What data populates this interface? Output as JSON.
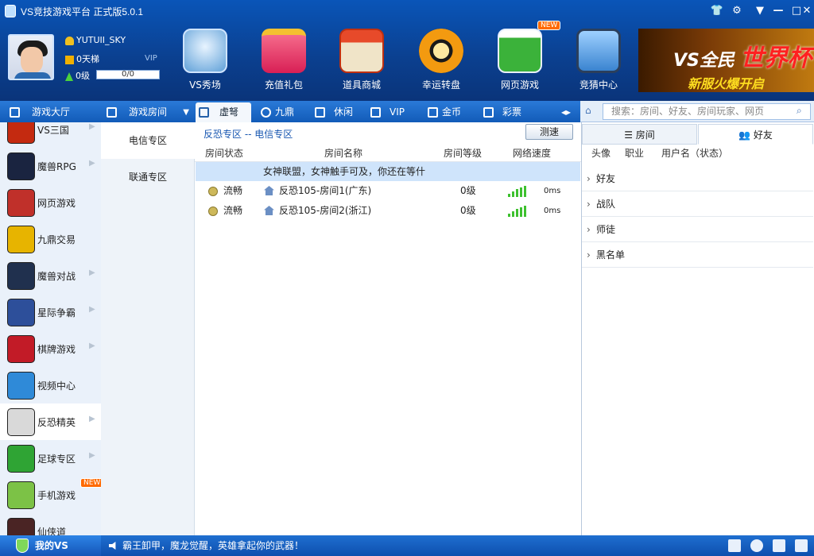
{
  "window": {
    "title": "VS竞技游戏平台 正式版5.0.1"
  },
  "user": {
    "name": "YUTUII_SKY",
    "ladder": "0天梯",
    "vip": "VIP",
    "level": "0级",
    "exp": "0/0"
  },
  "top_buttons": [
    {
      "label": "VS秀场",
      "icon": "microphone-icon"
    },
    {
      "label": "充值礼包",
      "icon": "gift-box-icon"
    },
    {
      "label": "道具商城",
      "icon": "shop-icon"
    },
    {
      "label": "幸运转盘",
      "icon": "lucky-wheel-icon"
    },
    {
      "label": "网页游戏",
      "icon": "gamepad-icon",
      "badge": "NEW"
    },
    {
      "label": "竞猜中心",
      "icon": "dice-icon"
    }
  ],
  "banner": {
    "t1": "VS全民",
    "t2": "世界杯",
    "t3": "新服火爆开启"
  },
  "tabs": [
    "游戏大厅",
    "游戏房间",
    "虚弩",
    "九鼎",
    "休闲",
    "VIP",
    "金币",
    "彩票"
  ],
  "search": {
    "placeholder": "搜索：房间、好友、房间玩家、网页"
  },
  "games": [
    {
      "label": "VS三国",
      "color": "#c42a10"
    },
    {
      "label": "魔兽RPG",
      "color": "#1a2440"
    },
    {
      "label": "网页游戏",
      "color": "#c0302a"
    },
    {
      "label": "九鼎交易",
      "color": "#e7b400"
    },
    {
      "label": "魔兽对战",
      "color": "#20304e"
    },
    {
      "label": "星际争霸",
      "color": "#2d4f9a"
    },
    {
      "label": "棋牌游戏",
      "color": "#c21b27"
    },
    {
      "label": "视频中心",
      "color": "#2f8ad8"
    },
    {
      "label": "反恐精英",
      "color": "#d9d9d9"
    },
    {
      "label": "足球专区",
      "color": "#2fa434"
    },
    {
      "label": "手机游戏",
      "color": "#7cc246",
      "badge": "NEW"
    },
    {
      "label": "仙侠道",
      "color": "#4a2424"
    }
  ],
  "zones": [
    "电信专区",
    "联通专区"
  ],
  "main": {
    "crumb": "反恐专区 -- 电信专区",
    "speed_btn": "测速",
    "headers": [
      "房间状态",
      "房间名称",
      "房间等级",
      "网络速度"
    ],
    "notice": "女神联盟，女神触手可及，你还在等什",
    "rooms": [
      {
        "status": "流畅",
        "name": "反恐105-房间1(广东)",
        "level": "0级",
        "ping": "0ms"
      },
      {
        "status": "流畅",
        "name": "反恐105-房间2(浙江)",
        "level": "0级",
        "ping": "0ms"
      }
    ]
  },
  "right": {
    "tabs": [
      "房间",
      "好友"
    ],
    "headers": [
      "头像",
      "职业",
      "用户名（状态）"
    ],
    "groups": [
      "好友",
      "战队",
      "师徒",
      "黑名单"
    ]
  },
  "bottom": {
    "myvs": "我的VS",
    "marquee": "霸王卸甲，魔龙觉醒，英雄拿起你的武器！"
  }
}
